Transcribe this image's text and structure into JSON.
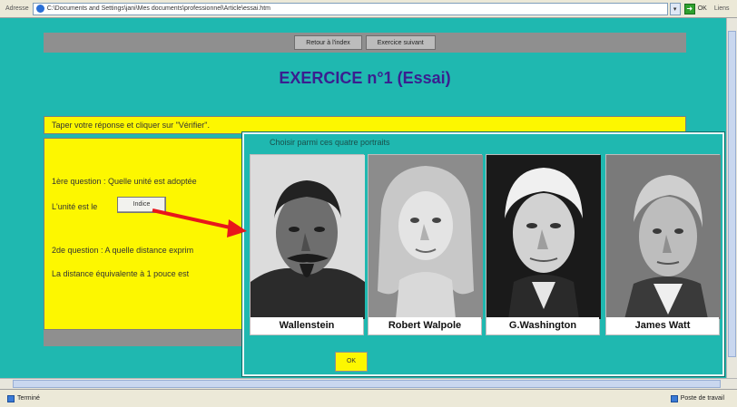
{
  "browser": {
    "address_label": "Adresse",
    "url": "C:\\Documents and Settings\\jani\\Mes documents\\professionnel\\Article\\essai.htm",
    "go_label": "OK",
    "links_label": "Liens"
  },
  "nav": {
    "back_label": "Retour à l'index",
    "next_label": "Exercice suivant"
  },
  "page": {
    "title": "EXERCICE n°1 (Essai)",
    "instruction": "Taper votre réponse et cliquer sur \"Vérifier\"."
  },
  "questions": {
    "q1": "1ère question : Quelle unité est adoptée",
    "answer1_prefix": "L'unité est le",
    "indice_label": "Indice",
    "q2": "2de question : A quelle distance exprim",
    "answer2_prefix": "La distance équivalente à 1 pouce est"
  },
  "popup": {
    "title": "Choisir parmi ces quatre portraits",
    "portraits": [
      {
        "name": "Wallenstein"
      },
      {
        "name": "Robert Walpole"
      },
      {
        "name": "G.Washington"
      },
      {
        "name": "James Watt"
      }
    ],
    "ok_label": "OK"
  },
  "status": {
    "left": "Terminé",
    "right": "Poste de travail"
  },
  "colors": {
    "page_bg": "#1fb8b0",
    "panel_yellow": "#fdf700",
    "title_purple": "#3a1f8f",
    "arrow_red": "#e8161b"
  }
}
